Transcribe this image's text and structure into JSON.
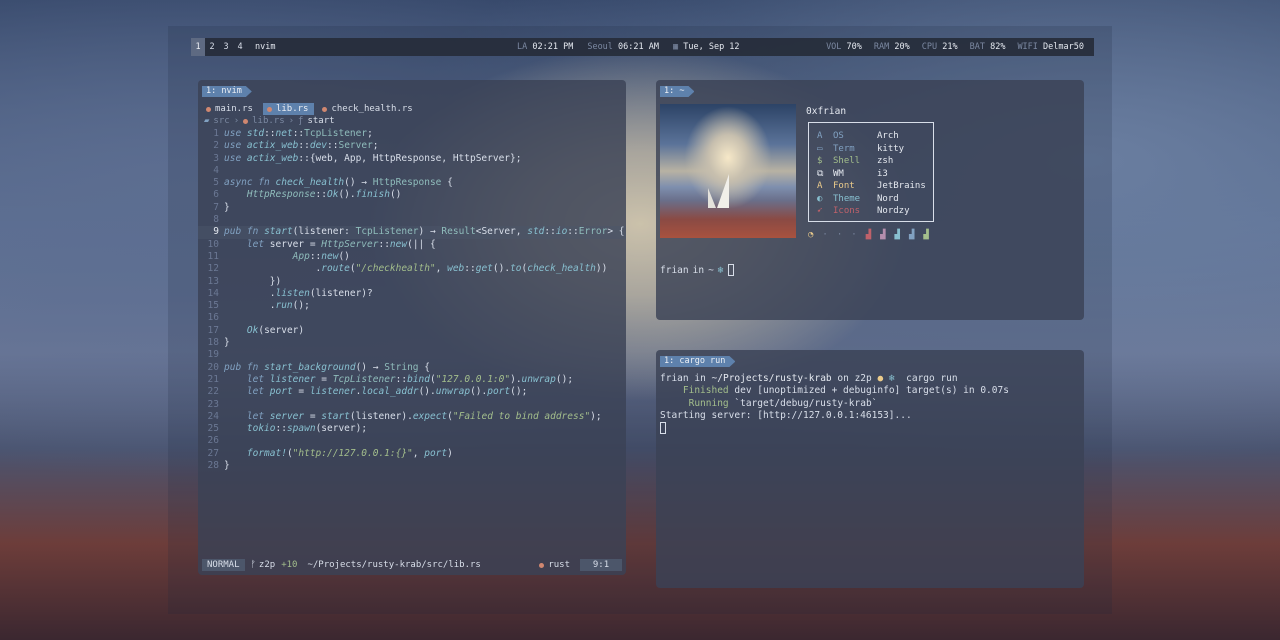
{
  "topbar": {
    "workspaces": [
      "1",
      "2",
      "3",
      "4"
    ],
    "active_workspace": "1",
    "window_title": "nvim",
    "la_label": "LA",
    "la_time": "02:21 PM",
    "seoul_label": "Seoul",
    "seoul_time": "06:21 AM",
    "date": "Tue, Sep 12",
    "vol_label": "VOL",
    "vol": "70%",
    "ram_label": "RAM",
    "ram": "20%",
    "cpu_label": "CPU",
    "cpu": "21%",
    "bat_label": "BAT",
    "bat": "82%",
    "wifi_label": "WIFI",
    "wifi": "Delmar50"
  },
  "nvim": {
    "tag": "1: nvim",
    "tabs": [
      "main.rs",
      "lib.rs",
      "check_health.rs"
    ],
    "breadcrumb": {
      "dir": "src",
      "file": "lib.rs",
      "fn": "start"
    },
    "status": {
      "mode": "NORMAL",
      "branch": "z2p",
      "diff": "+10",
      "path": "~/Projects/rusty-krab/src/lib.rs",
      "ft": "rust",
      "pos": "9:1"
    }
  },
  "fetch": {
    "tag": "1: ~",
    "username": "0xfrian",
    "rows": [
      {
        "icon": "A",
        "label": "OS",
        "value": "Arch",
        "color": "#81a1c1"
      },
      {
        "icon": "▭",
        "label": "Term",
        "value": "kitty",
        "color": "#81a1c1"
      },
      {
        "icon": "$",
        "label": "Shell",
        "value": "zsh",
        "color": "#a3be8c"
      },
      {
        "icon": "⧉",
        "label": "WM",
        "value": "i3",
        "color": "#e5e9f0"
      },
      {
        "icon": "A",
        "label": "Font",
        "value": "JetBrains",
        "color": "#ebcb8b"
      },
      {
        "icon": "◐",
        "label": "Theme",
        "value": "Nord",
        "color": "#88c0d0"
      },
      {
        "icon": "➹",
        "label": "Icons",
        "value": "Nordzy",
        "color": "#bf616a"
      }
    ],
    "prompt_user": "frian",
    "prompt_in": "in",
    "prompt_dir": "~"
  },
  "cargo": {
    "tag": "1: cargo run",
    "prompt_user": "frian",
    "prompt_in": "in",
    "prompt_dir": "~/Projects/rusty-krab",
    "prompt_on": "on",
    "prompt_branch": "z2p",
    "command": "cargo run",
    "finished_label": "Finished",
    "finished_text": "dev [unoptimized + debuginfo] target(s) in 0.07s",
    "running_label": "Running",
    "running_text": "`target/debug/rusty-krab`",
    "server_line": "Starting server: [http://127.0.0.1:46153]..."
  }
}
